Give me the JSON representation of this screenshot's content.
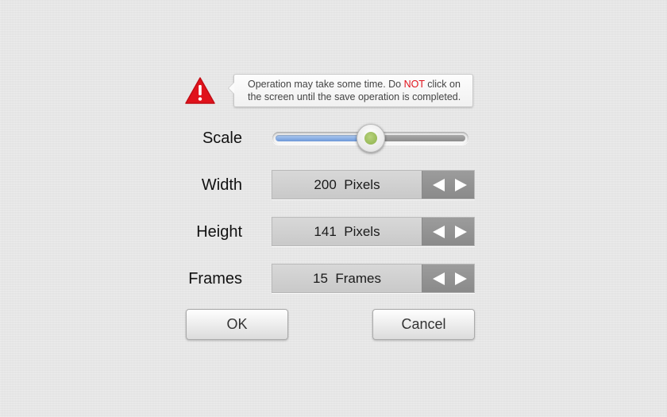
{
  "warning": {
    "icon": "warning-triangle-icon",
    "icon_color": "#e0121b",
    "text_before": "Operation may take some time. Do ",
    "emphasis": "NOT",
    "emphasis_color": "#e0121b",
    "text_after_line1": " click on",
    "text_line2": "the screen until the save operation is completed."
  },
  "scale": {
    "label": "Scale",
    "value_fraction": 0.5,
    "fill_color": "#6d98d8",
    "thumb_color": "#9dc05e"
  },
  "fields": [
    {
      "label": "Width",
      "value": "200",
      "unit": "Pixels"
    },
    {
      "label": "Height",
      "value": "141",
      "unit": "Pixels"
    },
    {
      "label": "Frames",
      "value": "15",
      "unit": "Frames"
    }
  ],
  "buttons": {
    "ok_label": "OK",
    "cancel_label": "Cancel"
  }
}
